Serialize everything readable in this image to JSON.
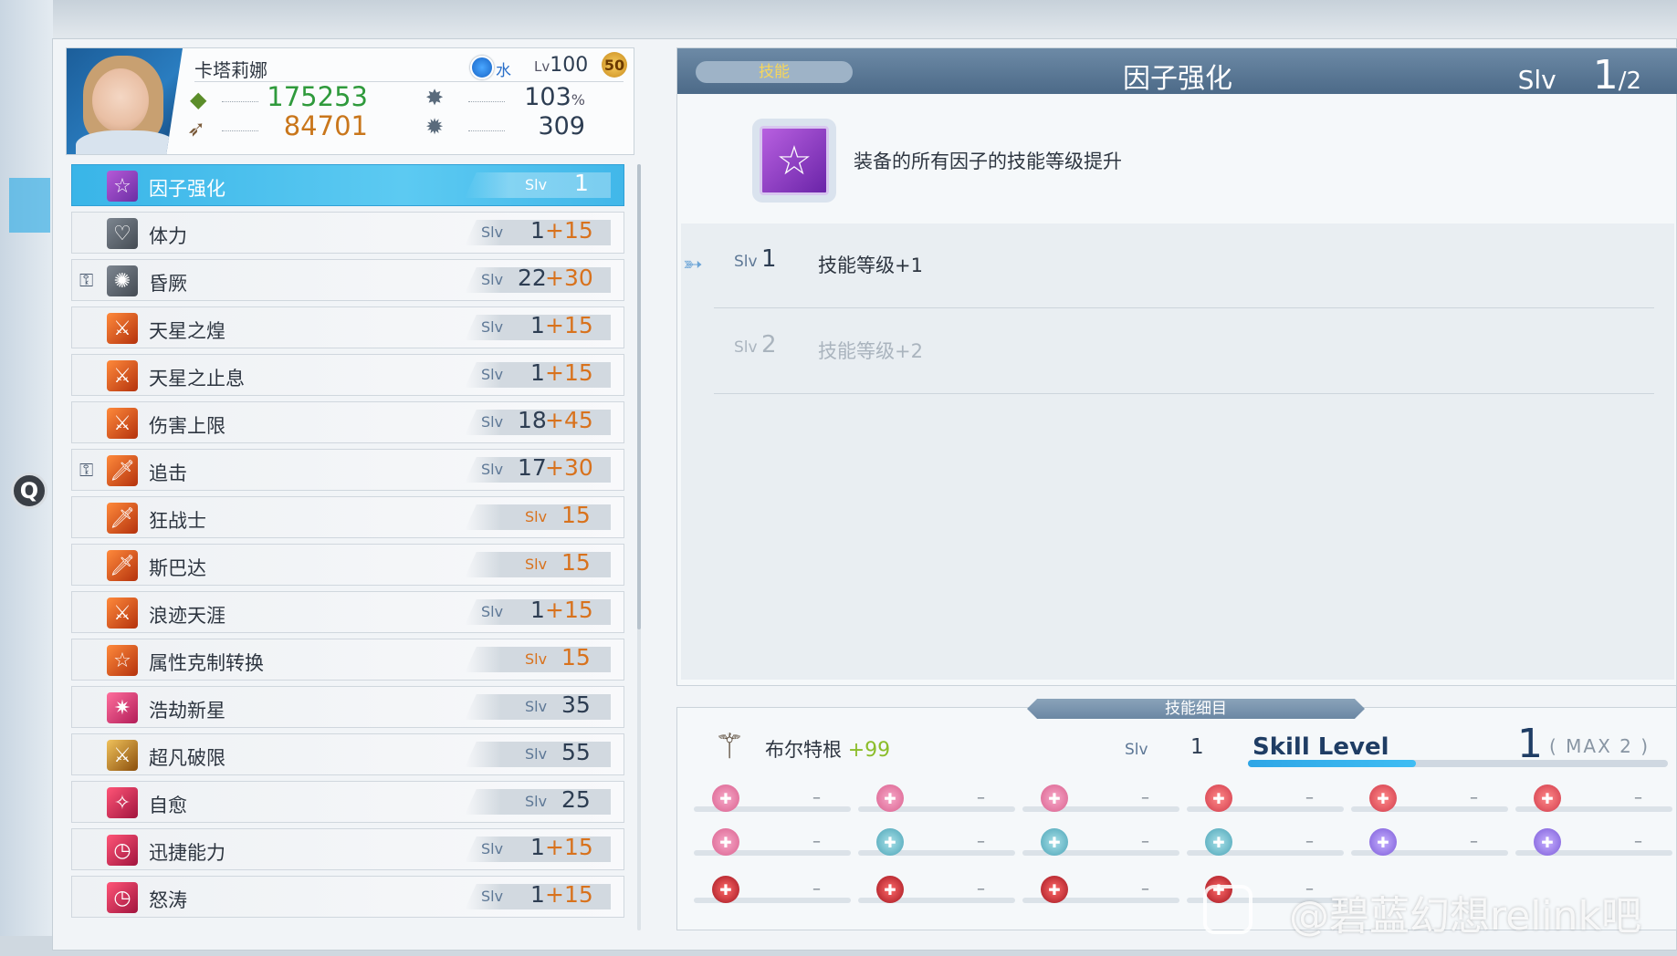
{
  "character": {
    "name": "卡塔莉娜",
    "element": "水",
    "level_prefix": "Lv",
    "level": "100",
    "level_badge": "50",
    "hp": "175253",
    "attack": "84701",
    "crit": "103",
    "crit_unit": "%",
    "stun": "309"
  },
  "skills": [
    {
      "name": "因子强化",
      "slv_label": "Slv",
      "base": "1",
      "plus": "",
      "selected": true
    },
    {
      "name": "体力",
      "slv_label": "Slv",
      "base": "1",
      "plus": "+15"
    },
    {
      "name": "昏厥",
      "slv_label": "Slv",
      "base": "22",
      "plus": "+30",
      "lock": true
    },
    {
      "name": "天星之煌",
      "slv_label": "Slv",
      "base": "1",
      "plus": "+15"
    },
    {
      "name": "天星之止息",
      "slv_label": "Slv",
      "base": "1",
      "plus": "+15"
    },
    {
      "name": "伤害上限",
      "slv_label": "Slv",
      "base": "18",
      "plus": "+45"
    },
    {
      "name": "追击",
      "slv_label": "Slv",
      "base": "17",
      "plus": "+30",
      "lock": true
    },
    {
      "name": "狂战士",
      "slv_label": "Slv",
      "only": "15"
    },
    {
      "name": "斯巴达",
      "slv_label": "Slv",
      "only": "15"
    },
    {
      "name": "浪迹天涯",
      "slv_label": "Slv",
      "base": "1",
      "plus": "+15"
    },
    {
      "name": "属性克制转换",
      "slv_label": "Slv",
      "only": "15"
    },
    {
      "name": "浩劫新星",
      "slv_label": "Slv",
      "only": "35"
    },
    {
      "name": "超凡破限",
      "slv_label": "Slv",
      "only": "55"
    },
    {
      "name": "自愈",
      "slv_label": "Slv",
      "only": "25"
    },
    {
      "name": "迅捷能力",
      "slv_label": "Slv",
      "base": "1",
      "plus": "+15"
    },
    {
      "name": "怒涛",
      "slv_label": "Slv",
      "base": "1",
      "plus": "+15"
    }
  ],
  "detail": {
    "tag": "技能",
    "title": "因子强化",
    "slv_label": "Slv",
    "slv_current": "1",
    "slv_max": "/2",
    "description": "装备的所有因子的技能等级提升",
    "levels": [
      {
        "label": "Slv",
        "num": "1",
        "effect": "技能等级+1",
        "active": true
      },
      {
        "label": "Slv",
        "num": "2",
        "effect": "技能等级+2",
        "active": false
      }
    ]
  },
  "sub": {
    "tab": "技能细目",
    "weapon_name": "布尔特根",
    "weapon_plus": "+99",
    "slv_label": "Slv",
    "slv_value": "1",
    "skill_level_label": "Skill Level",
    "level_current": "1",
    "level_max": "( MAX  2 )",
    "progress": 0.4,
    "dash": "–"
  },
  "q_button": "Q",
  "watermark": "@碧蓝幻想relink吧"
}
